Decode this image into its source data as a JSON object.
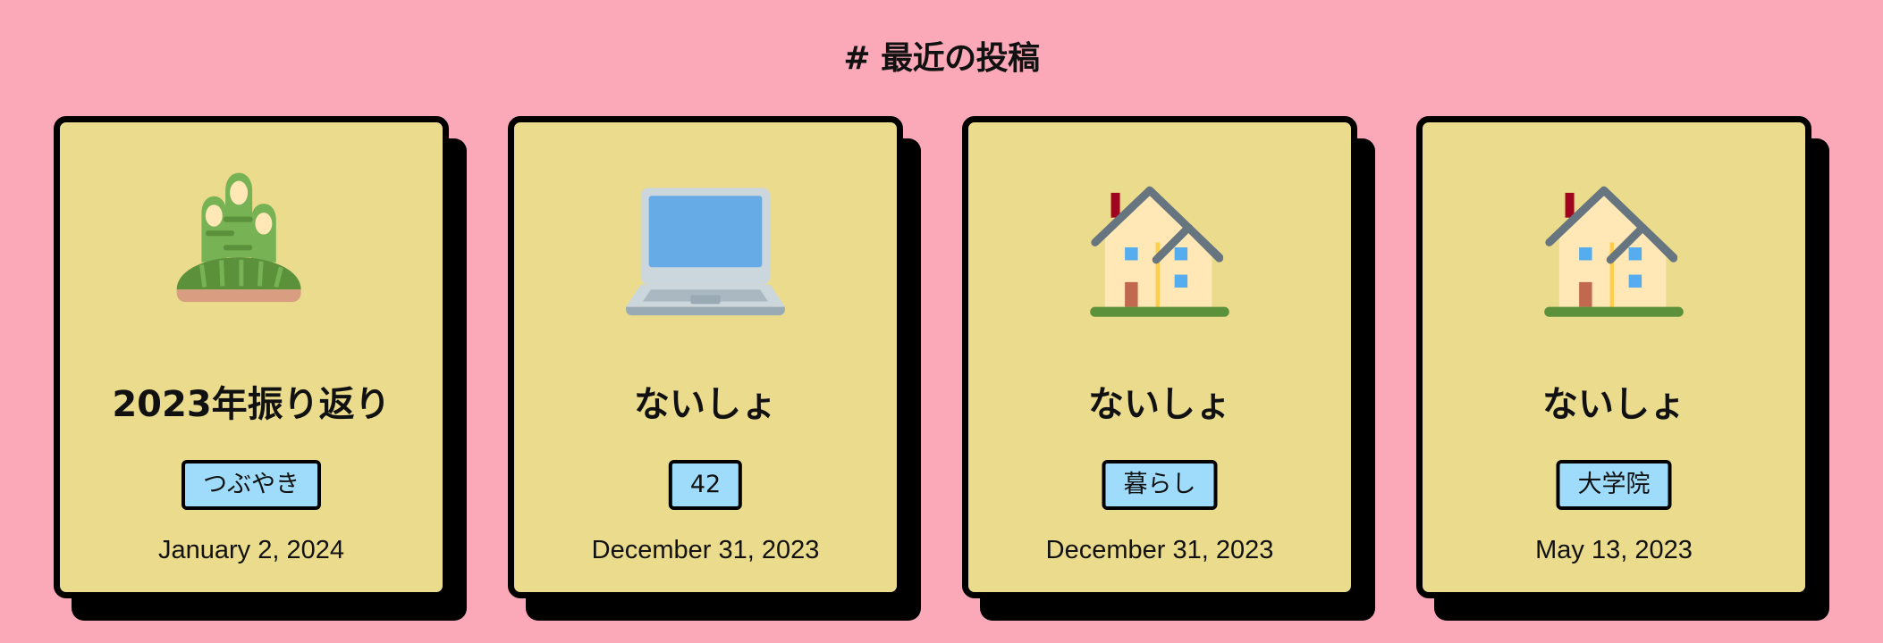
{
  "header": {
    "title": "# 最近の投稿"
  },
  "posts": [
    {
      "icon": "kadomatsu-icon",
      "title": "2023年振り返り",
      "tag": "つぶやき",
      "date": "January 2, 2024"
    },
    {
      "icon": "laptop-icon",
      "title": "ないしょ",
      "tag": "42",
      "date": "December 31, 2023"
    },
    {
      "icon": "house-icon",
      "title": "ないしょ",
      "tag": "暮らし",
      "date": "December 31, 2023"
    },
    {
      "icon": "house-icon",
      "title": "ないしょ",
      "tag": "大学院",
      "date": "May 13, 2023"
    }
  ],
  "colors": {
    "background": "#fba9b8",
    "card": "#ebdc8d",
    "tag": "#9fdcfb",
    "border": "#000000"
  }
}
